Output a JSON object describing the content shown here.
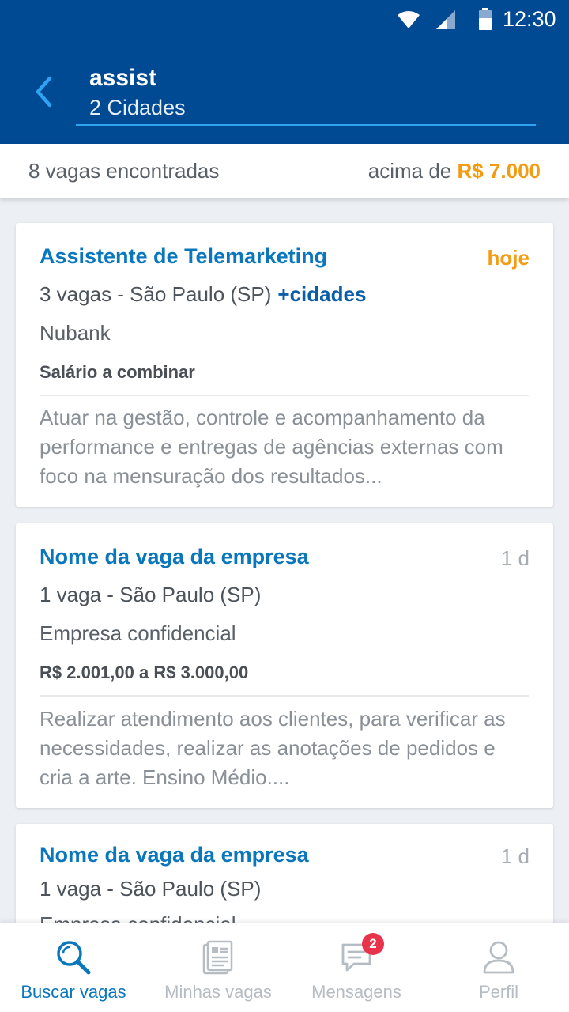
{
  "status_bar": {
    "time": "12:30"
  },
  "header": {
    "query": "assist",
    "cities": "2 Cidades"
  },
  "results": {
    "count_text": "8 vagas encontradas",
    "salary_prefix": "acima de",
    "salary_value": "R$ 7.000"
  },
  "jobs": [
    {
      "title": "Assistente de Telemarketing",
      "date": "hoje",
      "location": "3 vagas - São Paulo (SP)",
      "more_cities": "+cidades",
      "company": "Nubank",
      "salary": "Salário a combinar",
      "description": "Atuar na gestão, controle e acompanhamento da performance e entregas de agências externas com foco na mensuração dos resultados..."
    },
    {
      "title": "Nome da vaga da empresa",
      "date": "1 d",
      "location": "1 vaga - São Paulo (SP)",
      "company": "Empresa confidencial",
      "salary": "R$ 2.001,00 a R$ 3.000,00",
      "description": "Realizar atendimento aos clientes, para verificar as necessidades, realizar as anotações de pedidos e cria a arte. Ensino Médio...."
    },
    {
      "title": "Nome da vaga da empresa",
      "date": "1 d",
      "location": "1 vaga - São Paulo (SP)",
      "company": "Empresa confidencial"
    }
  ],
  "bottom_nav": {
    "items": [
      {
        "label": "Buscar vagas",
        "icon": "search-icon",
        "active": true
      },
      {
        "label": "Minhas vagas",
        "icon": "document-icon"
      },
      {
        "label": "Mensagens",
        "icon": "chat-icon",
        "badge": "2"
      },
      {
        "label": "Perfil",
        "icon": "user-icon"
      }
    ]
  },
  "colors": {
    "header": "#004a93",
    "link": "#0a77bd",
    "accent_orange": "#f39c12",
    "badge": "#e8334a"
  }
}
